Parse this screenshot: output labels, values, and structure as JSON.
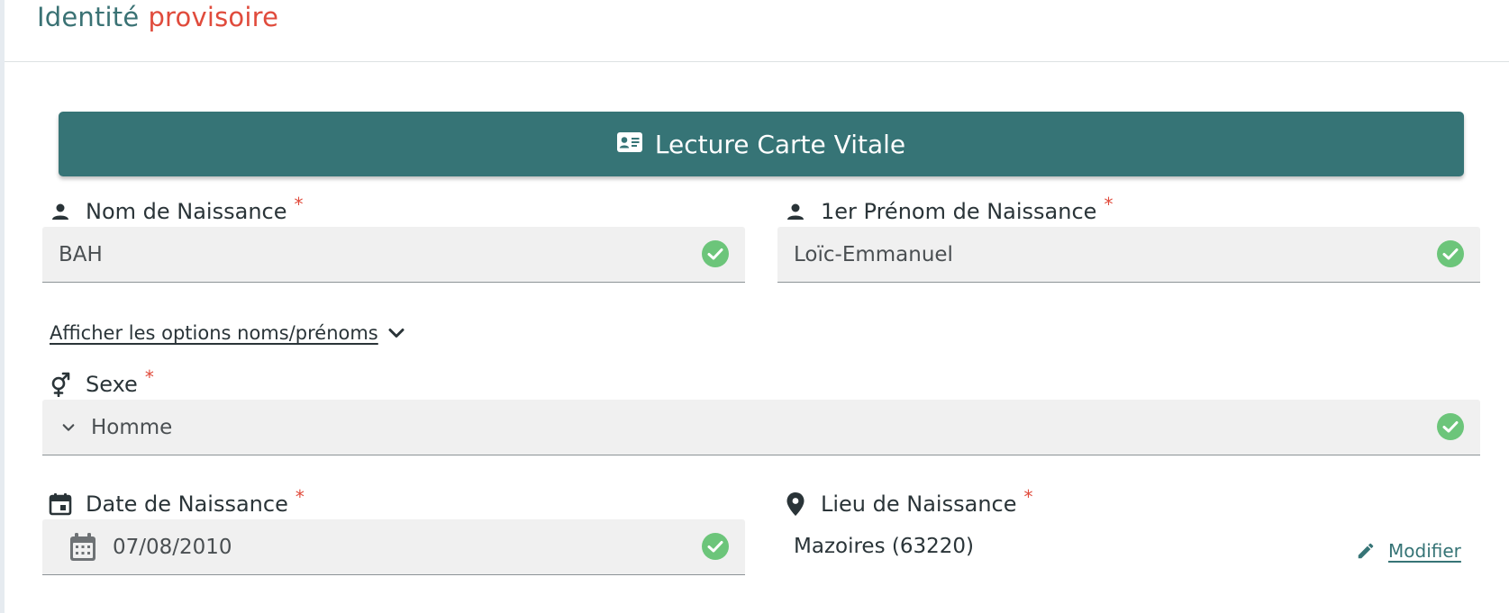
{
  "header": {
    "title_part1": "Identité",
    "title_part2": "provisoire"
  },
  "vitale_button": {
    "label": "Lecture Carte Vitale",
    "icon": "id-card-icon"
  },
  "nom": {
    "label": "Nom de Naissance",
    "required_mark": "*",
    "value": "BAH",
    "icon": "person-icon",
    "status_icon": "check-circle-icon"
  },
  "prenom": {
    "label": "1er Prénom de Naissance",
    "required_mark": "*",
    "value": "Loïc-Emmanuel",
    "icon": "person-icon",
    "status_icon": "check-circle-icon"
  },
  "options_link": {
    "label": "Afficher les options noms/prénoms",
    "icon": "chevron-down-icon"
  },
  "sexe": {
    "label": "Sexe",
    "required_mark": "*",
    "value": "Homme",
    "icon": "gender-icon",
    "status_icon": "check-circle-icon"
  },
  "date_naissance": {
    "label": "Date de Naissance",
    "required_mark": "*",
    "value": "07/08/2010",
    "icon": "calendar-icon",
    "status_icon": "check-circle-icon"
  },
  "lieu_naissance": {
    "label": "Lieu de Naissance",
    "required_mark": "*",
    "value": "Mazoires (63220)",
    "icon": "location-pin-icon",
    "edit_label": "Modifier"
  },
  "colors": {
    "brand_teal": "#367476",
    "accent_red": "#e04b3c",
    "success_green": "#6cc57a",
    "field_bg": "#f0f0f0"
  }
}
